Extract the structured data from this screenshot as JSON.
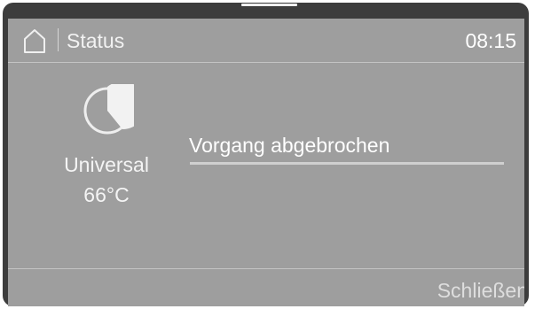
{
  "header": {
    "home_icon": "home-icon",
    "title": "Status",
    "time": "08:15"
  },
  "program": {
    "icon": "program-pie-icon",
    "name": "Universal",
    "temperature": "66°C"
  },
  "status": {
    "message": "Vorgang abgebrochen"
  },
  "footer": {
    "close_label": "Schließen"
  },
  "colors": {
    "bezel": "#3d3d3d",
    "screen": "#9e9e9e",
    "text": "#ffffff"
  }
}
